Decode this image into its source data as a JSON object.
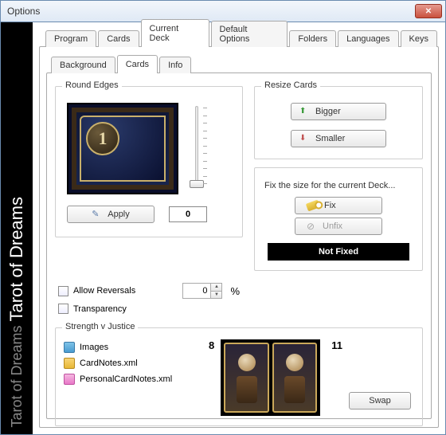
{
  "window": {
    "title": "Options"
  },
  "sidebar": {
    "dim_text": "Tarot of Dreams  ",
    "bright_text": "Tarot of Dreams"
  },
  "tabs_outer": {
    "items": [
      "Program",
      "Cards",
      "Current Deck",
      "Default Options",
      "Folders",
      "Languages",
      "Keys"
    ],
    "active": "Current Deck"
  },
  "tabs_inner": {
    "items": [
      "Background",
      "Cards",
      "Info"
    ],
    "active": "Cards"
  },
  "round_edges": {
    "legend": "Round Edges",
    "coin_label": "1",
    "apply_label": "Apply",
    "value": "0"
  },
  "resize": {
    "legend": "Resize Cards",
    "bigger_label": "Bigger",
    "smaller_label": "Smaller"
  },
  "fix": {
    "legend_text": "Fix the size for the current Deck...",
    "fix_label": "Fix",
    "unfix_label": "Unfix",
    "status": "Not Fixed"
  },
  "reversals": {
    "allow_label": "Allow Reversals",
    "transparency_label": "Transparency",
    "spin_value": "0",
    "percent": "%"
  },
  "svj": {
    "legend": "Strength v Justice",
    "files": {
      "images": "Images",
      "cardnotes": "CardNotes.xml",
      "personal": "PersonalCardNotes.xml"
    },
    "left_num": "8",
    "right_num": "11",
    "swap_label": "Swap"
  }
}
